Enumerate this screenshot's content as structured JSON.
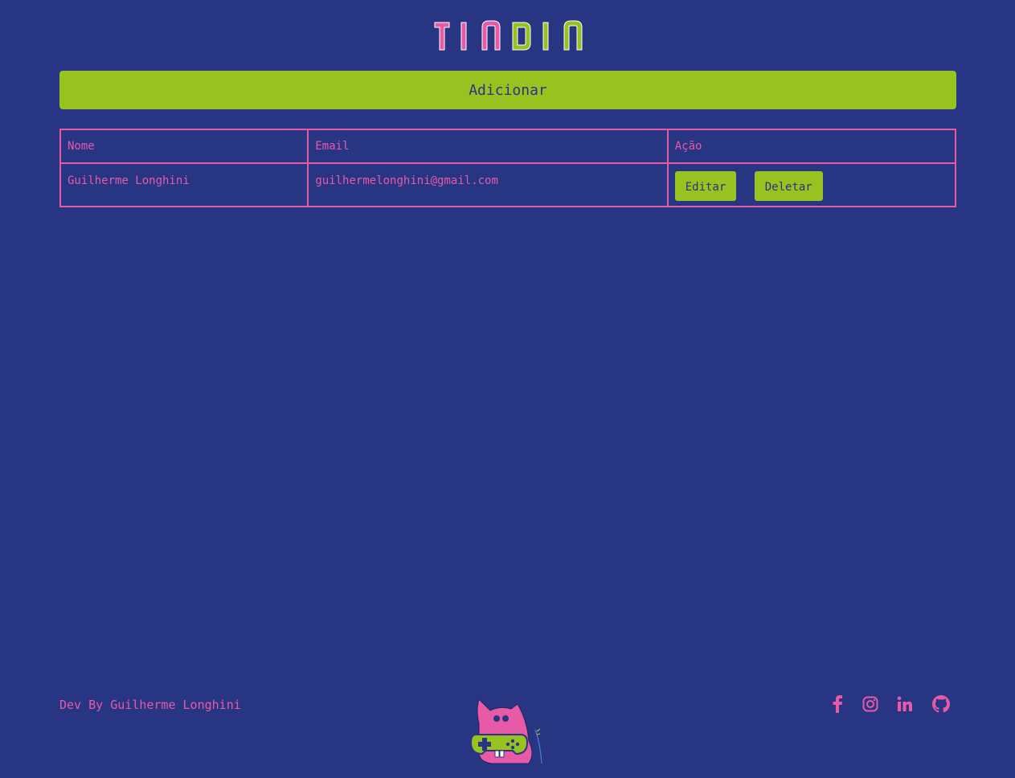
{
  "header": {
    "logo_text": "TINDIN"
  },
  "actions": {
    "add_label": "Adicionar"
  },
  "table": {
    "columns": [
      "Nome",
      "Email",
      "Ação"
    ],
    "rows": [
      {
        "name": "Guilherme Longhini",
        "email": "guilhermelonghini@gmail.com",
        "edit_label": "Editar",
        "delete_label": "Deletar"
      }
    ]
  },
  "footer": {
    "credit": "Dev By Guilherme Longhini",
    "social_icons": [
      "facebook-icon",
      "instagram-icon",
      "linkedin-icon",
      "github-icon"
    ]
  },
  "colors": {
    "background": "#283583",
    "accent_green": "#98c21f",
    "accent_pink": "#e75aa6"
  }
}
